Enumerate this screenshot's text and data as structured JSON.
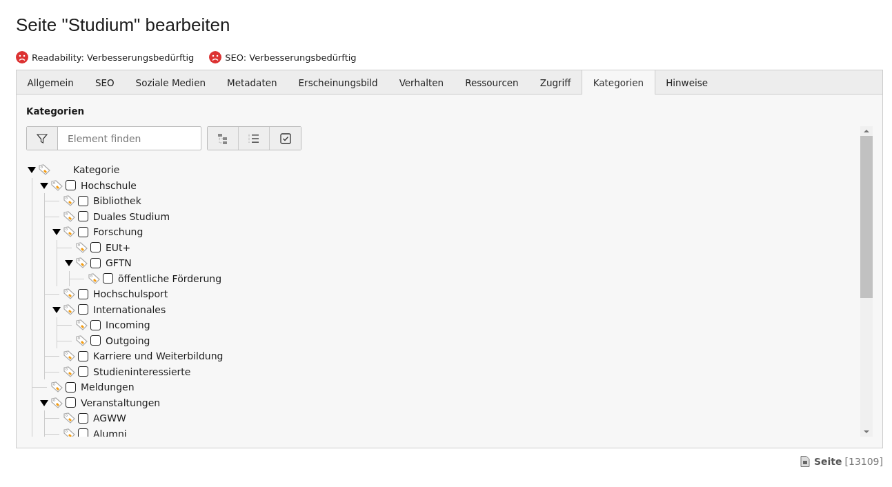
{
  "title": "Seite \"Studium\" bearbeiten",
  "scores": [
    {
      "label": "Readability: Verbesserungsbedürftig",
      "color": "#dc3232"
    },
    {
      "label": "SEO: Verbesserungsbedürftig",
      "color": "#dc3232"
    }
  ],
  "tabs": [
    {
      "label": "Allgemein",
      "selected": false
    },
    {
      "label": "SEO",
      "selected": false
    },
    {
      "label": "Soziale Medien",
      "selected": false
    },
    {
      "label": "Metadaten",
      "selected": false
    },
    {
      "label": "Erscheinungsbild",
      "selected": false
    },
    {
      "label": "Verhalten",
      "selected": false
    },
    {
      "label": "Ressourcen",
      "selected": false
    },
    {
      "label": "Zugriff",
      "selected": false
    },
    {
      "label": "Kategorien",
      "selected": true
    },
    {
      "label": "Hinweise",
      "selected": false
    }
  ],
  "section_title": "Kategorien",
  "search": {
    "placeholder": "Element finden"
  },
  "tree": {
    "label": "Kategorie",
    "expanded": true,
    "children": [
      {
        "label": "Hochschule",
        "checked": false,
        "expanded": true,
        "children": [
          {
            "label": "Bibliothek",
            "checked": false
          },
          {
            "label": "Duales Studium",
            "checked": false
          },
          {
            "label": "Forschung",
            "checked": false,
            "expanded": true,
            "children": [
              {
                "label": "EUt+",
                "checked": false
              },
              {
                "label": "GFTN",
                "checked": false,
                "expanded": true,
                "children": [
                  {
                    "label": "öffentliche Förderung",
                    "checked": false
                  }
                ]
              }
            ]
          },
          {
            "label": "Hochschulsport",
            "checked": false
          },
          {
            "label": "Internationales",
            "checked": false,
            "expanded": true,
            "children": [
              {
                "label": "Incoming",
                "checked": false
              },
              {
                "label": "Outgoing",
                "checked": false
              }
            ]
          },
          {
            "label": "Karriere und Weiterbildung",
            "checked": false
          },
          {
            "label": "Studieninteressierte",
            "checked": false
          }
        ]
      },
      {
        "label": "Meldungen",
        "checked": false
      },
      {
        "label": "Veranstaltungen",
        "checked": false,
        "expanded": true,
        "children": [
          {
            "label": "AGWW",
            "checked": false
          },
          {
            "label": "Alumni",
            "checked": false
          }
        ]
      }
    ]
  },
  "footer": {
    "record_type": "Seite",
    "record_id": "[13109]"
  }
}
